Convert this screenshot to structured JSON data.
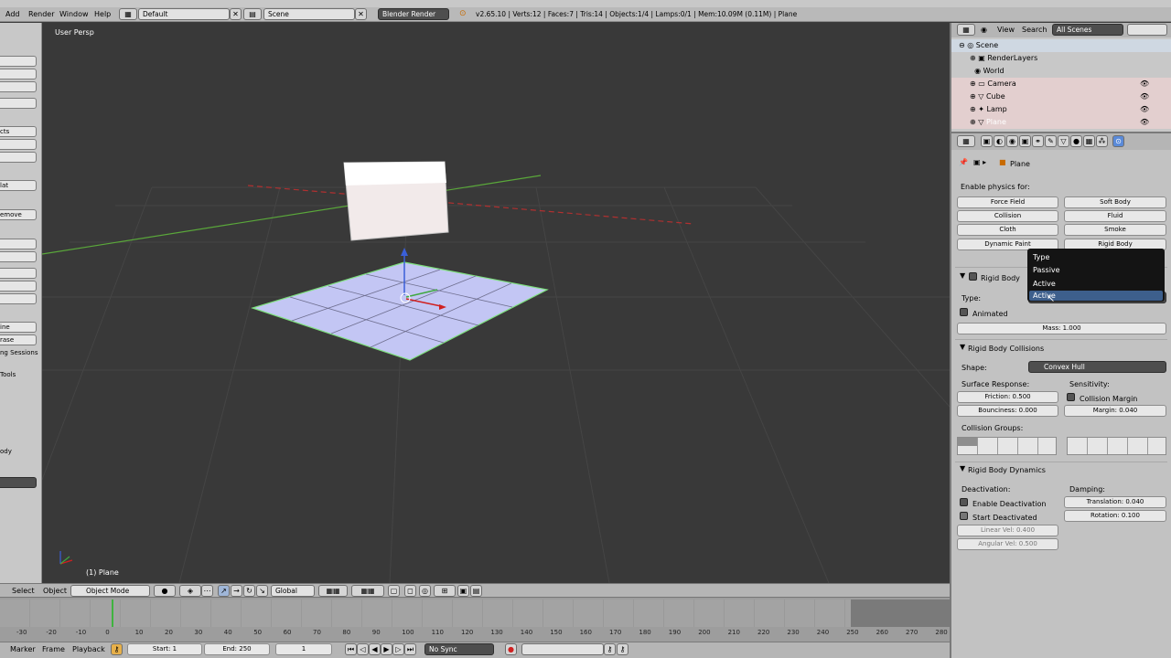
{
  "top_menu": {
    "items": [
      "Add",
      "Render",
      "Window",
      "Help"
    ],
    "layout": "Default",
    "scene": "Scene",
    "engine": "Blender Render",
    "info": "v2.65.10 | Verts:12 | Faces:7 | Tris:14 | Objects:1/4 | Lamps:0/1 | Mem:10.09M (0.11M) | Plane"
  },
  "left_panel": {
    "labels": [
      "cts",
      "lat",
      "emove",
      "ine",
      "rase",
      "ng Sessions",
      "Tools",
      "ody"
    ]
  },
  "viewport": {
    "title": "User Persp",
    "object_label": "(1) Plane"
  },
  "view3d_header": {
    "select": "Select",
    "object": "Object",
    "mode": "Object Mode",
    "orientation": "Global"
  },
  "timeline": {
    "ticks": [
      "-30",
      "-20",
      "-10",
      "0",
      "10",
      "20",
      "30",
      "40",
      "50",
      "60",
      "70",
      "80",
      "90",
      "100",
      "110",
      "120",
      "130",
      "140",
      "150",
      "160",
      "170",
      "180",
      "190",
      "200",
      "210",
      "220",
      "230",
      "240",
      "250",
      "260",
      "270",
      "280"
    ],
    "marker": "Marker",
    "frame": "Frame",
    "playback": "Playback",
    "start": "Start: 1",
    "end": "End: 250",
    "current": "1",
    "sync": "No Sync"
  },
  "outliner": {
    "view": "View",
    "search": "Search",
    "filter": "All Scenes",
    "items": [
      "Scene",
      "RenderLayers",
      "World",
      "Camera",
      "Cube",
      "Lamp",
      "Plane"
    ]
  },
  "properties": {
    "object_name": "Plane",
    "enable_physics_label": "Enable physics for:",
    "physics_buttons": [
      "Force Field",
      "Soft Body",
      "Collision",
      "Fluid",
      "Cloth",
      "Smoke",
      "Dynamic Paint",
      "Rigid Body"
    ],
    "rigid_body": {
      "title": "Rigid Body",
      "type_label": "Type:",
      "type_value": "Active",
      "animated": "Animated",
      "mass": "Mass: 1.000"
    },
    "dropdown": {
      "title": "Type",
      "options": [
        "Passive",
        "Active"
      ],
      "hover": "Active"
    },
    "collisions": {
      "title": "Rigid Body Collisions",
      "shape_label": "Shape:",
      "shape_value": "Convex Hull",
      "surface": "Surface Response:",
      "sensitivity": "Sensitivity:",
      "friction": "Friction: 0.500",
      "bounciness": "Bounciness: 0.000",
      "collision_margin": "Collision Margin",
      "margin": "Margin: 0.040",
      "groups": "Collision Groups:"
    },
    "dynamics": {
      "title": "Rigid Body Dynamics",
      "deactivation": "Deactivation:",
      "damping": "Damping:",
      "enable_deactivation": "Enable Deactivation",
      "start_deactivated": "Start Deactivated",
      "translation": "Translation: 0.040",
      "rotation": "Rotation: 0.100",
      "linear_vel": "Linear Vel: 0.400",
      "angular_vel": "Angular Vel: 0.500"
    }
  },
  "colors": {
    "selection_outline": "#7fe07f",
    "plane_fill": "#c3c6f4",
    "x_axis": "#c0392b",
    "y_axis": "#6fb23a"
  }
}
